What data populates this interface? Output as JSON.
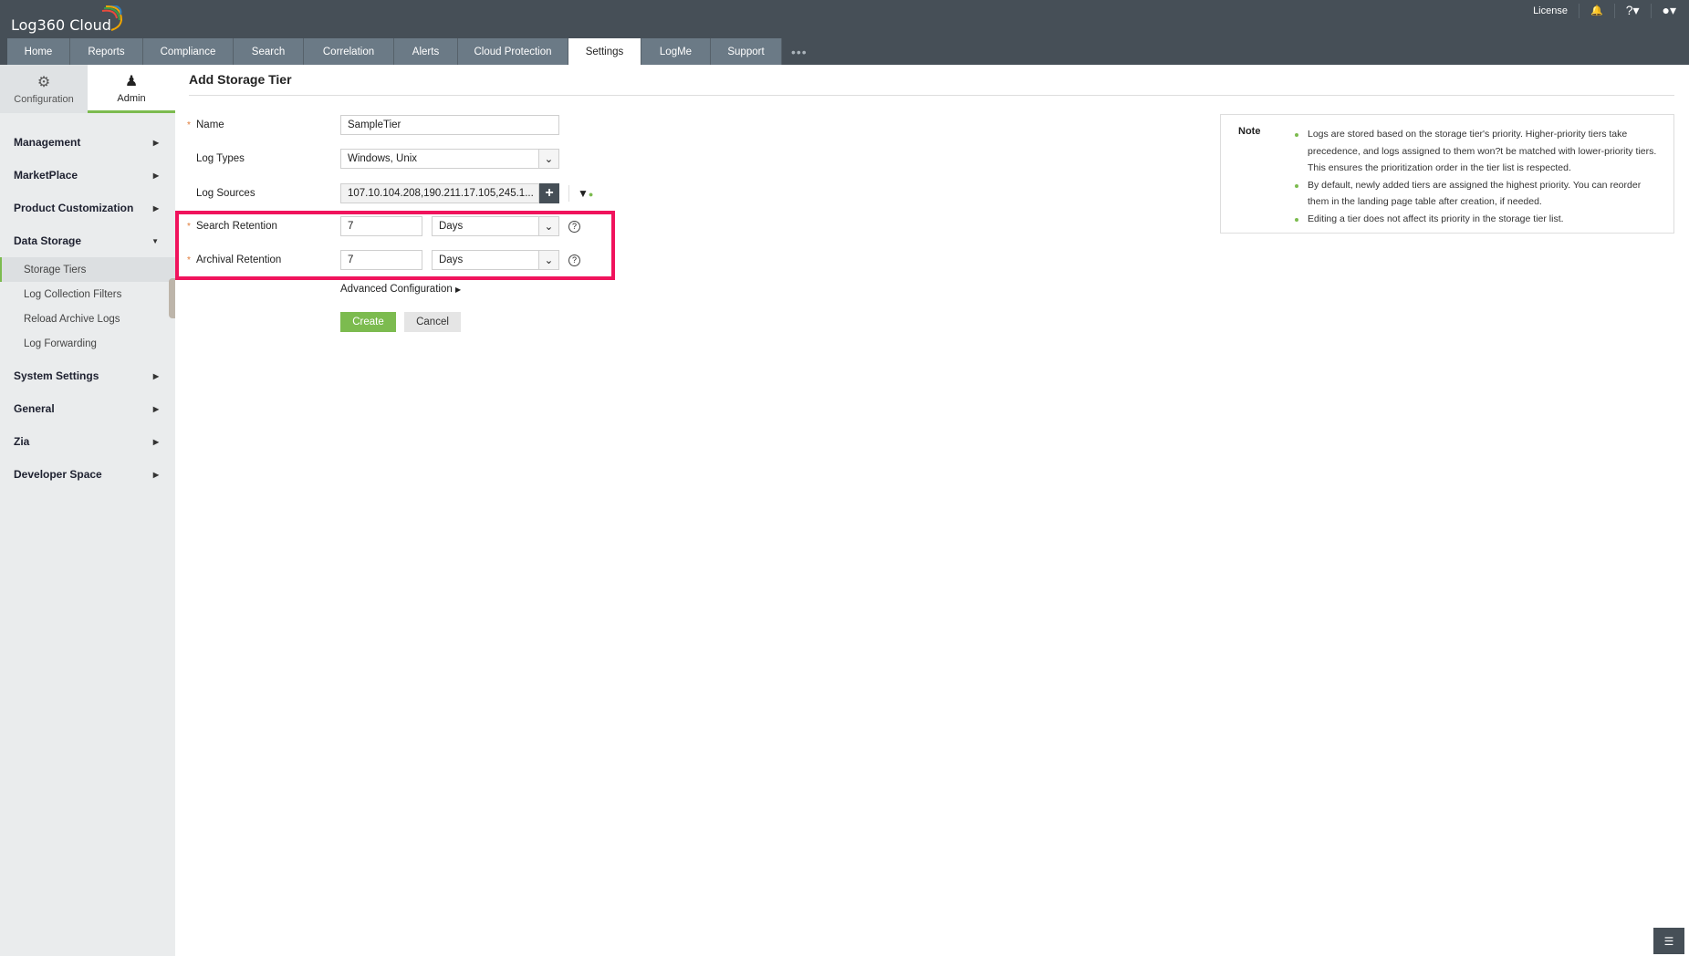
{
  "app": {
    "logo": "Log360 Cloud",
    "license": "License"
  },
  "nav": {
    "tabs": [
      "Home",
      "Reports",
      "Compliance",
      "Search",
      "Correlation",
      "Alerts",
      "Cloud Protection",
      "Settings",
      "LogMe",
      "Support"
    ],
    "active": "Settings"
  },
  "sidebar": {
    "config_tab": "Configuration",
    "admin_tab": "Admin",
    "items": [
      {
        "label": "Management"
      },
      {
        "label": "MarketPlace"
      },
      {
        "label": "Product Customization"
      },
      {
        "label": "Data Storage"
      },
      {
        "label": "System Settings"
      },
      {
        "label": "General"
      },
      {
        "label": "Zia"
      },
      {
        "label": "Developer Space"
      }
    ],
    "data_storage_sub": [
      "Storage Tiers",
      "Log Collection Filters",
      "Reload Archive Logs",
      "Log Forwarding"
    ]
  },
  "form": {
    "title": "Add Storage Tier",
    "name_label": "Name",
    "name_value": "SampleTier",
    "log_types_label": "Log Types",
    "log_types_value": "Windows, Unix",
    "log_sources_label": "Log Sources",
    "log_sources_value": "107.10.104.208,190.211.17.105,245.1...",
    "search_label": "Search Retention",
    "search_value": "7",
    "search_unit": "Days",
    "archival_label": "Archival Retention",
    "archival_value": "7",
    "archival_unit": "Days",
    "advanced": "Advanced Configuration",
    "create": "Create",
    "cancel": "Cancel"
  },
  "note": {
    "title": "Note",
    "items": [
      "Logs are stored based on the storage tier's priority. Higher-priority tiers take precedence, and logs assigned to them won?t be matched with lower-priority tiers. This ensures the prioritization order in the tier list is respected.",
      "By default, newly added tiers are assigned the highest priority. You can reorder them in the landing page table after creation, if needed.",
      "Editing a tier does not affect its priority in the storage tier list."
    ]
  },
  "colors": {
    "header": "#464f57",
    "tab": "#6b7a86",
    "accent": "#7cbb4f",
    "highlight": "#f0135c"
  }
}
